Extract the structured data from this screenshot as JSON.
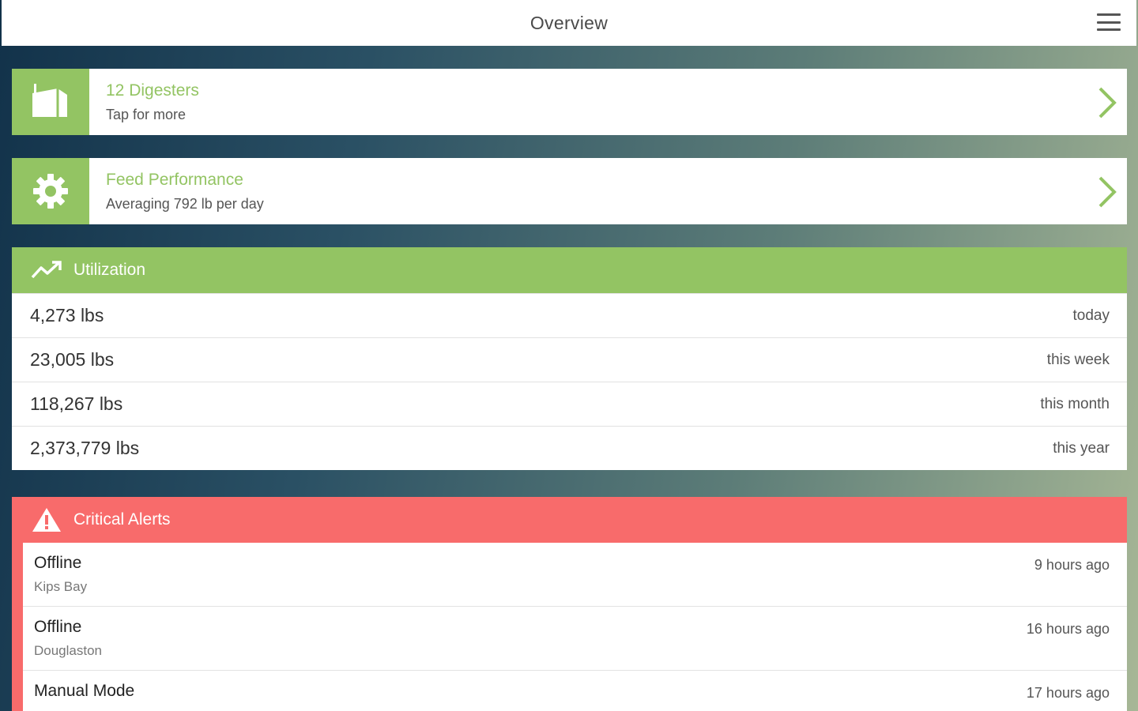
{
  "header": {
    "title": "Overview",
    "menu_icon": "hamburger-menu-icon"
  },
  "cards": [
    {
      "title": "12 Digesters",
      "subtitle": "Tap for more",
      "icon": "digester-icon"
    },
    {
      "title": "Feed Performance",
      "subtitle": "Averaging 792 lb per day",
      "icon": "gear-icon"
    }
  ],
  "utilization": {
    "title": "Utilization",
    "icon": "trending-up-icon",
    "rows": [
      {
        "value": "4,273 lbs",
        "period": "today"
      },
      {
        "value": "23,005 lbs",
        "period": "this week"
      },
      {
        "value": "118,267 lbs",
        "period": "this month"
      },
      {
        "value": "2,373,779 lbs",
        "period": "this year"
      }
    ]
  },
  "alerts": {
    "title": "Critical Alerts",
    "icon": "warning-icon",
    "items": [
      {
        "title": "Offline",
        "location": "Kips Bay",
        "time": "9 hours ago"
      },
      {
        "title": "Offline",
        "location": "Douglaston",
        "time": "16 hours ago"
      },
      {
        "title": "Manual Mode",
        "location": "",
        "time": "17 hours ago"
      }
    ]
  },
  "colors": {
    "accent_green": "#93c463",
    "alert_red": "#f86b6b",
    "background_dark": "#12324a"
  }
}
